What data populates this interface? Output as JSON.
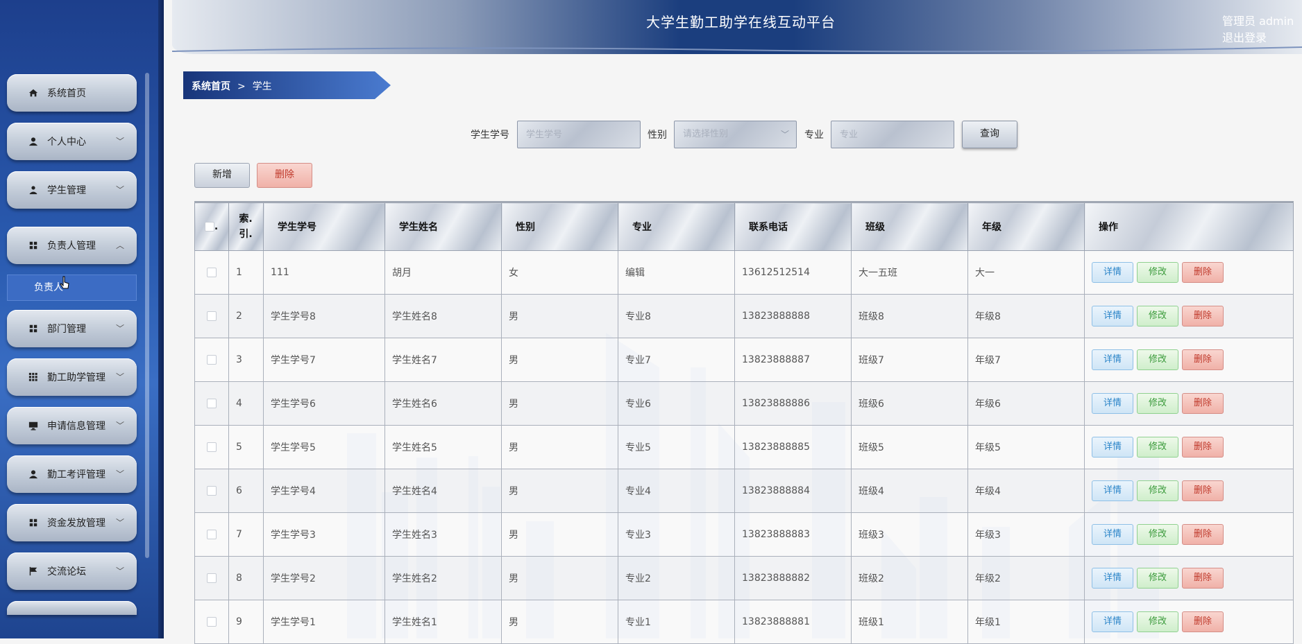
{
  "header": {
    "title": "大学生勤工助学在线互动平台",
    "user_label": "管理员 admin",
    "logout_label": "退出登录"
  },
  "sidebar": {
    "items": [
      {
        "label": "系统首页",
        "icon": "home-icon",
        "has_chevron": false
      },
      {
        "label": "个人中心",
        "icon": "user-icon",
        "has_chevron": true
      },
      {
        "label": "学生管理",
        "icon": "person-icon",
        "has_chevron": true
      },
      {
        "label": "负责人管理",
        "icon": "grid-icon",
        "has_chevron": true,
        "expanded": true
      },
      {
        "label": "部门管理",
        "icon": "grid-icon",
        "has_chevron": true
      },
      {
        "label": "勤工助学管理",
        "icon": "apps-icon",
        "has_chevron": true
      },
      {
        "label": "申请信息管理",
        "icon": "monitor-icon",
        "has_chevron": true
      },
      {
        "label": "勤工考评管理",
        "icon": "user-icon",
        "has_chevron": true
      },
      {
        "label": "资金发放管理",
        "icon": "grid-icon",
        "has_chevron": true
      },
      {
        "label": "交流论坛",
        "icon": "flag-icon",
        "has_chevron": true
      }
    ],
    "submenu_label": "负责人"
  },
  "breadcrumb": {
    "home": "系统首页",
    "separator": ">",
    "current": "学生"
  },
  "search": {
    "student_no_label": "学生学号",
    "student_no_placeholder": "学生学号",
    "gender_label": "性别",
    "gender_placeholder": "请选择性别",
    "major_label": "专业",
    "major_placeholder": "专业",
    "query_label": "查询"
  },
  "actions": {
    "add_label": "新增",
    "delete_label": "删除"
  },
  "table": {
    "headers": [
      "索引",
      "学生学号",
      "学生姓名",
      "性别",
      "专业",
      "联系电话",
      "班级",
      "年级",
      "操作"
    ],
    "index_header_line1": "索.",
    "index_header_line2": "引.",
    "row_actions": {
      "detail": "详情",
      "edit": "修改",
      "delete": "删除"
    },
    "rows": [
      [
        "1",
        "111",
        "胡月",
        "女",
        "编辑",
        "13612512514",
        "大一五班",
        "大一"
      ],
      [
        "2",
        "学生学号8",
        "学生姓名8",
        "男",
        "专业8",
        "13823888888",
        "班级8",
        "年级8"
      ],
      [
        "3",
        "学生学号7",
        "学生姓名7",
        "男",
        "专业7",
        "13823888887",
        "班级7",
        "年级7"
      ],
      [
        "4",
        "学生学号6",
        "学生姓名6",
        "男",
        "专业6",
        "13823888886",
        "班级6",
        "年级6"
      ],
      [
        "5",
        "学生学号5",
        "学生姓名5",
        "男",
        "专业5",
        "13823888885",
        "班级5",
        "年级5"
      ],
      [
        "6",
        "学生学号4",
        "学生姓名4",
        "男",
        "专业4",
        "13823888884",
        "班级4",
        "年级4"
      ],
      [
        "7",
        "学生学号3",
        "学生姓名3",
        "男",
        "专业3",
        "13823888883",
        "班级3",
        "年级3"
      ],
      [
        "8",
        "学生学号2",
        "学生姓名2",
        "男",
        "专业2",
        "13823888882",
        "班级2",
        "年级2"
      ],
      [
        "9",
        "学生学号1",
        "学生姓名1",
        "男",
        "专业1",
        "13823888881",
        "班级1",
        "年级1"
      ]
    ]
  },
  "colors": {
    "sidebar": "#2a5bb0",
    "header_center": "#1b3e7e",
    "danger": "#c0392b",
    "info": "#2a84c8",
    "success": "#3a9a3a"
  }
}
